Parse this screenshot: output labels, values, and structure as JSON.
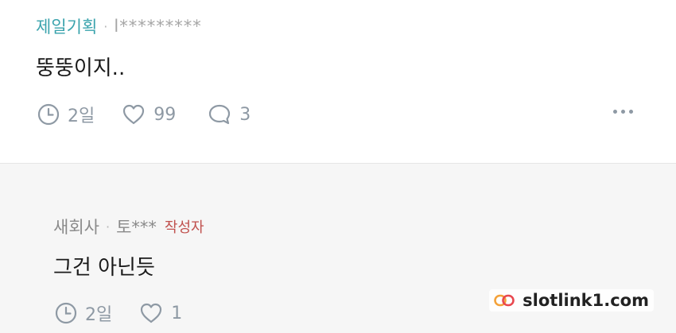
{
  "top_comment": {
    "author": "제일기획",
    "separator": "·",
    "user_id": "l*********",
    "text": "뚱뚱이지..",
    "time": "2일",
    "likes": "99",
    "replies": "3"
  },
  "reply_comment": {
    "author": "새회사",
    "separator": "·",
    "user_id": "토***",
    "op_badge": "작성자",
    "text": "그건 아닌듯",
    "time": "2일",
    "likes": "1"
  },
  "watermark": {
    "text": "slotlink1.com",
    "colors": [
      "#f4a23a",
      "#e8484f"
    ]
  },
  "icons": [
    "clock-icon",
    "heart-icon",
    "speech-bubble-icon",
    "more-dots-icon"
  ],
  "colors": {
    "top_author": "#3aa3ad",
    "op_badge": "#c0504d",
    "action_gray": "#8e99a4",
    "reply_background": "#f6f6f6"
  }
}
